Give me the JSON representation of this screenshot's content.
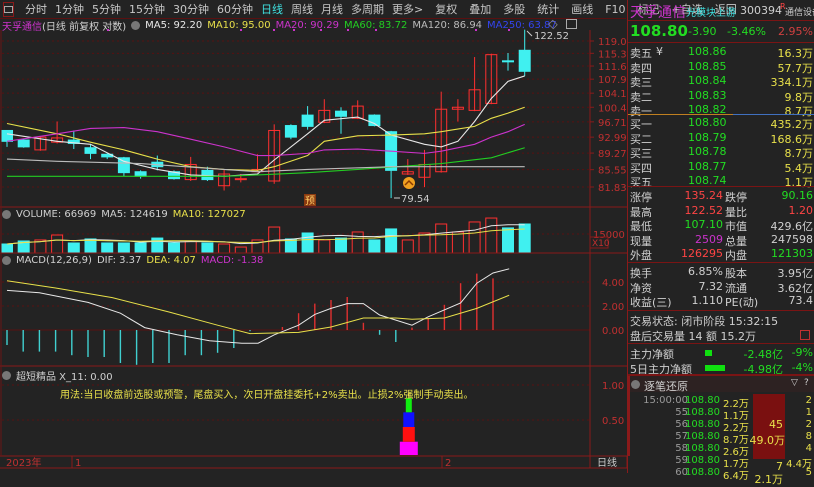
{
  "toolbar": {
    "items": [
      "分时",
      "1分钟",
      "5分钟",
      "15分钟",
      "30分钟",
      "60分钟",
      "日线",
      "周线",
      "月线",
      "多周期",
      "更多>"
    ],
    "active": "日线",
    "tools": [
      "复权",
      "叠加",
      "多股",
      "统计",
      "画线",
      "F10",
      "标记",
      "+自选",
      "返回"
    ]
  },
  "title": {
    "name": "天孚通信",
    "mode": "(日线 前复权 对数)",
    "ma5": "MA5: 92.20",
    "ma10": "MA10: 95.00",
    "ma20": "MA20: 90.29",
    "ma60": "MA60: 83.72",
    "ma120": "MA120: 86.94",
    "ma250": "MA250: 63.87"
  },
  "colors": {
    "up": "#ff3030",
    "down": "#40f0f0",
    "ma5": "#e8e8e8",
    "ma10": "#e8e04a",
    "ma20": "#cc33cc",
    "ma60": "#22cc22",
    "ma120": "#bbbbbb",
    "grid": "#5a1010"
  },
  "price_chart": {
    "scale": "log",
    "ymax": 119.0,
    "ymin": 81.83,
    "y_ticks": [
      "119.0",
      "115.3",
      "111.6",
      "107.9",
      "104.1",
      "100.4",
      "96.71",
      "92.99",
      "89.27",
      "85.55",
      "81.83"
    ],
    "high_label": "122.52",
    "low_label": "79.54",
    "badge": "预",
    "candles": [
      [
        94.6,
        94.6,
        90.7,
        92.0
      ],
      [
        92.3,
        92.5,
        90.5,
        90.7
      ],
      [
        90.0,
        93.2,
        89.8,
        93.0
      ],
      [
        91.8,
        96.8,
        91.5,
        92.8
      ],
      [
        92.3,
        94.6,
        90.2,
        91.5
      ],
      [
        90.5,
        91.3,
        87.9,
        89.2
      ],
      [
        89.0,
        89.2,
        87.9,
        88.4
      ],
      [
        88.2,
        88.4,
        84.1,
        84.9
      ],
      [
        85.1,
        85.4,
        83.6,
        84.1
      ],
      [
        87.2,
        88.7,
        85.4,
        86.2
      ],
      [
        85.1,
        85.4,
        83.4,
        83.6
      ],
      [
        83.4,
        88.4,
        83.1,
        86.7
      ],
      [
        85.4,
        86.2,
        83.1,
        83.4
      ],
      [
        82.1,
        85.6,
        81.1,
        84.6
      ],
      [
        83.4,
        84.6,
        82.8,
        83.6
      ],
      [
        85.1,
        89.0,
        84.9,
        85.6
      ],
      [
        83.1,
        96.1,
        82.5,
        94.6
      ],
      [
        95.8,
        96.1,
        92.5,
        93.0
      ],
      [
        98.4,
        100.7,
        94.8,
        95.6
      ],
      [
        96.6,
        102.5,
        96.4,
        99.6
      ],
      [
        99.4,
        100.4,
        93.8,
        98.1
      ],
      [
        97.6,
        102.2,
        97.4,
        100.7
      ],
      [
        98.4,
        98.6,
        95.6,
        95.8
      ],
      [
        94.3,
        94.5,
        79.54,
        85.4
      ],
      [
        84.6,
        87.9,
        84.4,
        85.1
      ],
      [
        83.9,
        90.0,
        81.8,
        86.7
      ],
      [
        85.1,
        104.5,
        84.9,
        99.9
      ],
      [
        99.9,
        102.5,
        96.8,
        100.4
      ],
      [
        99.6,
        114.2,
        99.4,
        105.0
      ],
      [
        101.4,
        115.2,
        101.2,
        114.9
      ],
      [
        113.1,
        115.4,
        110.3,
        112.9
      ],
      [
        116.2,
        122.52,
        108.8,
        110.1
      ]
    ],
    "ma": {
      "ma5": [
        [
          0,
          93.8
        ],
        [
          3,
          92.0
        ],
        [
          5,
          91.3
        ],
        [
          7,
          87.4
        ],
        [
          9,
          85.6
        ],
        [
          11,
          84.4
        ],
        [
          13,
          84.1
        ],
        [
          15,
          84.6
        ],
        [
          16,
          87.7
        ],
        [
          18,
          93.8
        ],
        [
          19,
          97.1
        ],
        [
          21,
          97.9
        ],
        [
          22,
          96.3
        ],
        [
          23,
          93.5
        ],
        [
          25,
          91.3
        ],
        [
          26,
          90.7
        ],
        [
          27,
          92.0
        ],
        [
          28,
          96.8
        ],
        [
          29,
          102.7
        ],
        [
          30,
          107.3
        ],
        [
          31,
          108.8
        ]
      ],
      "ma10": [
        [
          0,
          96.3
        ],
        [
          3,
          93.8
        ],
        [
          5,
          91.8
        ],
        [
          7,
          90.0
        ],
        [
          9,
          87.9
        ],
        [
          11,
          86.2
        ],
        [
          13,
          85.6
        ],
        [
          15,
          85.4
        ],
        [
          16,
          86.2
        ],
        [
          18,
          88.7
        ],
        [
          19,
          92.0
        ],
        [
          21,
          93.3
        ],
        [
          23,
          93.5
        ],
        [
          25,
          93.8
        ],
        [
          26,
          94.3
        ],
        [
          28,
          95.6
        ],
        [
          29,
          97.6
        ],
        [
          30,
          98.9
        ],
        [
          31,
          100.4
        ]
      ],
      "ma20": [
        [
          0,
          92.0
        ],
        [
          3,
          93.8
        ],
        [
          5,
          95.1
        ],
        [
          7,
          95.3
        ],
        [
          9,
          94.3
        ],
        [
          11,
          92.5
        ],
        [
          13,
          90.7
        ],
        [
          15,
          88.7
        ],
        [
          16,
          88.7
        ],
        [
          18,
          89.2
        ],
        [
          19,
          90.0
        ],
        [
          21,
          90.2
        ],
        [
          23,
          89.7
        ],
        [
          25,
          89.2
        ],
        [
          26,
          89.7
        ],
        [
          28,
          91.3
        ],
        [
          29,
          93.0
        ],
        [
          30,
          94.3
        ],
        [
          31,
          96.1
        ]
      ],
      "ma60": [
        [
          0,
          84.1
        ],
        [
          13,
          84.1
        ],
        [
          15,
          84.4
        ],
        [
          18,
          84.9
        ],
        [
          21,
          85.6
        ],
        [
          26,
          86.9
        ],
        [
          29,
          88.2
        ],
        [
          31,
          90.5
        ]
      ],
      "ma120": [
        [
          0,
          87.9
        ],
        [
          3,
          87.4
        ],
        [
          8,
          86.9
        ],
        [
          13,
          85.6
        ],
        [
          15,
          85.1
        ],
        [
          18,
          85.6
        ],
        [
          23,
          86.2
        ],
        [
          31,
          86.2
        ]
      ]
    }
  },
  "volume": {
    "label": "VOLUME: 66969",
    "ma5": "MA5: 124619",
    "ma10": "MA10: 127027",
    "y_tick": "15000",
    "unit": "X10",
    "tick_value": 150000,
    "values": [
      71000,
      95000,
      103000,
      142000,
      79000,
      111000,
      79000,
      79000,
      79000,
      118000,
      79000,
      95000,
      79000,
      71000,
      47000,
      103000,
      205000,
      111000,
      158000,
      103000,
      118000,
      166000,
      103000,
      190000,
      103000,
      158000,
      229000,
      166000,
      245000,
      276000,
      198000,
      229000
    ]
  },
  "macd": {
    "label": "MACD(12,26,9)",
    "dif_label": "DIF: 3.37",
    "dea_label": "DEA: 4.07",
    "macd_label": "MACD: -1.38",
    "y_ticks": [
      "4.00",
      "2.00",
      "0.00"
    ],
    "hist": [
      -1.25,
      -1.8,
      -1.8,
      -1.8,
      -2.1,
      -2.25,
      -2.25,
      -2.75,
      -2.9,
      -2.75,
      -2.75,
      -2.1,
      -2.1,
      -1.9,
      -1.5,
      -0.1,
      0.0,
      0.25,
      1.4,
      2.2,
      2.5,
      2.75,
      0.6,
      -0.4,
      -1.0,
      0.2,
      1.0,
      2.1,
      3.9,
      4.7,
      4.3,
      0.0
    ],
    "dif": [
      [
        0,
        3.3
      ],
      [
        2,
        3.1
      ],
      [
        5,
        2.3
      ],
      [
        7,
        1.4
      ],
      [
        8.5,
        0.2
      ],
      [
        10.5,
        -0.4
      ],
      [
        12.5,
        -0.9
      ],
      [
        14.5,
        -1.1
      ],
      [
        15.5,
        -1.1
      ],
      [
        16.5,
        -0.4
      ],
      [
        18,
        0.4
      ],
      [
        19,
        1.3
      ],
      [
        20,
        1.8
      ],
      [
        21,
        2.2
      ],
      [
        22,
        2.2
      ],
      [
        23,
        1.25
      ],
      [
        25,
        0.4
      ],
      [
        26,
        1.1
      ],
      [
        28,
        2.25
      ],
      [
        29,
        3.9
      ],
      [
        30,
        4.75
      ],
      [
        31,
        5.1
      ]
    ],
    "dea": [
      [
        0,
        4.1
      ],
      [
        3,
        3.5
      ],
      [
        6.5,
        2.7
      ],
      [
        10,
        1.5
      ],
      [
        13,
        0.4
      ],
      [
        15,
        -0.3
      ],
      [
        18,
        -0.2
      ],
      [
        20,
        0.25
      ],
      [
        22,
        1.0
      ],
      [
        24,
        1.0
      ],
      [
        25,
        0.9
      ],
      [
        27,
        1.0
      ],
      [
        29,
        1.8
      ],
      [
        31,
        2.9
      ]
    ]
  },
  "indicator": {
    "label": "超短精品 X_11: 0.00",
    "note": "用法:当日收盘前选股或预警，尾盘买入，次日开盘挂委托+2%卖出。止损2%强制手动卖出。",
    "y_ticks": [
      "1.00",
      "0.50"
    ],
    "signal_index": 24,
    "stack": [
      {
        "value": 0.19,
        "color": "#ff00ff"
      },
      {
        "value": 0.4,
        "color": "#ff1010"
      },
      {
        "value": 0.61,
        "color": "#1010ff"
      },
      {
        "value": 0.81,
        "color": "#10ee10"
      }
    ]
  },
  "time_axis": {
    "year": "2023年",
    "m1": "1",
    "m2": "2",
    "period": "日线"
  },
  "quote": {
    "name": "天孚通信",
    "sector": "光模块上游",
    "code": "300394",
    "flag": "R",
    "industry": "通信设备",
    "price": "108.80",
    "change": "-3.90",
    "pct": "-3.46%",
    "amp": "2.95%",
    "asks": [
      {
        "label": "卖五",
        "price": "108.86",
        "vol": "16.3万"
      },
      {
        "label": "卖四",
        "price": "108.85",
        "vol": "57.7万"
      },
      {
        "label": "卖三",
        "price": "108.84",
        "vol": "334.1万"
      },
      {
        "label": "卖二",
        "price": "108.83",
        "vol": "9.8万"
      },
      {
        "label": "卖一",
        "price": "108.82",
        "vol": "8.7万"
      }
    ],
    "ask_mark": "¥",
    "bids": [
      {
        "label": "买一",
        "price": "108.80",
        "vol": "435.2万"
      },
      {
        "label": "买二",
        "price": "108.79",
        "vol": "168.6万"
      },
      {
        "label": "买三",
        "price": "108.78",
        "vol": "8.7万"
      },
      {
        "label": "买四",
        "price": "108.77",
        "vol": "5.4万"
      },
      {
        "label": "买五",
        "price": "108.74",
        "vol": "1.1万"
      }
    ],
    "stats": [
      {
        "l1": "涨停",
        "v1": "135.24",
        "c1": "r",
        "l2": "跌停",
        "v2": "90.16",
        "c2": "g"
      },
      {
        "l1": "最高",
        "v1": "122.52",
        "c1": "r",
        "l2": "量比",
        "v2": "1.20",
        "c2": "r"
      },
      {
        "l1": "最低",
        "v1": "107.10",
        "c1": "g",
        "l2": "市值",
        "v2": "429.6亿",
        "c2": "w"
      },
      {
        "l1": "现量",
        "v1": "2509",
        "c1": "m",
        "l2": "总量",
        "v2": "247598",
        "c2": "w"
      },
      {
        "l1": "外盘",
        "v1": "126295",
        "c1": "r",
        "l2": "内盘",
        "v2": "121303",
        "c2": "g"
      }
    ],
    "stats2": [
      {
        "l1": "换手",
        "v1": "6.85%",
        "l2": "股本",
        "v2": "3.95亿"
      },
      {
        "l1": "净资",
        "v1": "7.32",
        "l2": "流通",
        "v2": "3.62亿"
      },
      {
        "l1": "收益(三)",
        "v1": "1.110",
        "l2": "PE(动)",
        "v2": "73.4"
      }
    ],
    "status": "交易状态: 闭市阶段 15:32:15",
    "after_hours": "盘后交易量 14 额 15.2万",
    "flow": [
      {
        "label": "主力净额",
        "value": "-2.48亿",
        "pct": "-9%",
        "bar": 0.35
      },
      {
        "label": "5日主力净额",
        "value": "-4.98亿",
        "pct": "-4%",
        "bar": 1.0
      }
    ],
    "ticks_title": "逐笔还原",
    "ticks": [
      {
        "t": "15:00:00",
        "p": "108.80",
        "v": "2.2万",
        "n": "2"
      },
      {
        "t": "55",
        "p": "108.80",
        "v": "1.1万",
        "n": "1"
      },
      {
        "t": "56",
        "p": "108.80",
        "v": "2.2万",
        "n": "2"
      },
      {
        "t": "57",
        "p": "108.80",
        "v": "8.7万",
        "n": "8"
      },
      {
        "t": "58",
        "p": "108.80",
        "v": "2.6万",
        "n": "4"
      },
      {
        "t": "59",
        "p": "108.80",
        "v": "1.7万",
        "n": "4.4万"
      },
      {
        "t": "60",
        "p": "108.80",
        "v": "6.4万",
        "n": "5"
      }
    ],
    "block1_count": "45",
    "block1_amount": "49.0万",
    "block2_count": "7",
    "block3_amount": "2.1万"
  }
}
